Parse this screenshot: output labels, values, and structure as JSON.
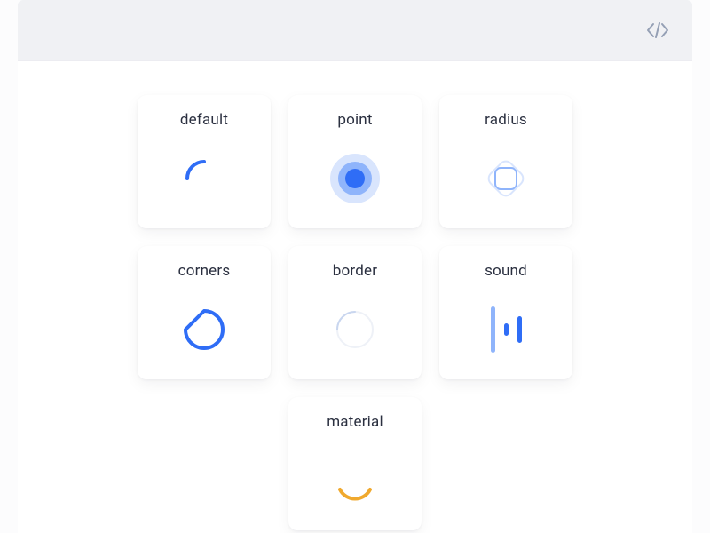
{
  "cards": {
    "default": {
      "label": "default"
    },
    "point": {
      "label": "point"
    },
    "radius": {
      "label": "radius"
    },
    "corners": {
      "label": "corners"
    },
    "border": {
      "label": "border"
    },
    "sound": {
      "label": "sound"
    },
    "material": {
      "label": "material"
    }
  },
  "colors": {
    "primary": "#2f6df6",
    "primary_light": "#8fb4fb",
    "primary_faint": "#d9e5fd",
    "accent": "#f0a92e",
    "border_faint": "#e7ecf4",
    "text": "#2b3040",
    "code_icon": "#95a0b5"
  },
  "topbar": {
    "icon": "code-icon"
  }
}
